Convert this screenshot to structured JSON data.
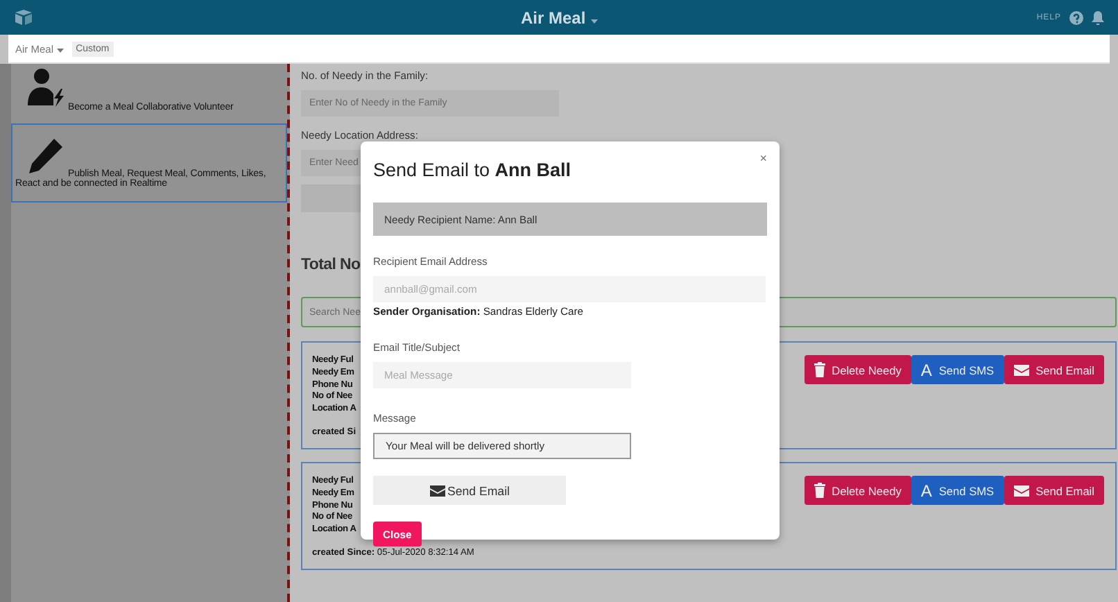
{
  "app_bar": {
    "title": "Air Meal",
    "help": "HELP"
  },
  "toolbar": {
    "base": "Air Meal",
    "view": "Custom"
  },
  "sidebar": {
    "items": [
      {
        "kind": "volunteer",
        "label": "Become a Meal Collaborative Volunteer",
        "selected": false
      },
      {
        "kind": "publish",
        "label": "Publish Meal, Request Meal, Comments, Likes, React and be connected in Realtime",
        "selected": true
      }
    ]
  },
  "form": {
    "fields": [
      {
        "label": "No. of Needy in the Family:",
        "placeholder": "Enter No of Needy in the Family"
      },
      {
        "label": "Needy Location Address:",
        "placeholder": "Enter Need"
      }
    ],
    "heading": "Total No",
    "search": {
      "placeholder": "Search Nee"
    }
  },
  "cards": [
    {
      "lines": [
        "Needy Ful",
        "Needy Em",
        "Phone Nu",
        "No of Nee",
        "Location A"
      ],
      "created_label": "created Si",
      "buttons": [
        {
          "kind": "delete",
          "label": "Delete Needy"
        },
        {
          "kind": "sms",
          "icon": "A",
          "label": "Send SMS"
        },
        {
          "kind": "email",
          "label": "Send Email"
        }
      ]
    },
    {
      "lines": [
        "Needy Ful",
        "Needy Em",
        "Phone Nu",
        "No of Nee",
        "Location A"
      ],
      "created_label": "created Since:",
      "created_value": "05-Jul-2020 8:32:14 AM",
      "buttons": [
        {
          "kind": "delete",
          "label": "Delete Needy"
        },
        {
          "kind": "sms",
          "icon": "A",
          "label": "Send SMS"
        },
        {
          "kind": "email",
          "label": "Send Email"
        }
      ]
    }
  ],
  "dialog": {
    "title": "Send Email to **Ann Ball**",
    "close_icon": "×",
    "recipient": "Needy Recipient Name: Ann Ball",
    "email_label": "Recipient Email Address",
    "email_placeholder": "annball@gmail.com",
    "sender": "**Sender Organisation:** Sandras Elderly Care",
    "subject_label": "Email Title/Subject",
    "subject_placeholder": "Meal Message",
    "message_label": "Message",
    "message_value": "Your Meal will be delivered shortly",
    "send_button": "Send Email",
    "close_button": "Close"
  }
}
